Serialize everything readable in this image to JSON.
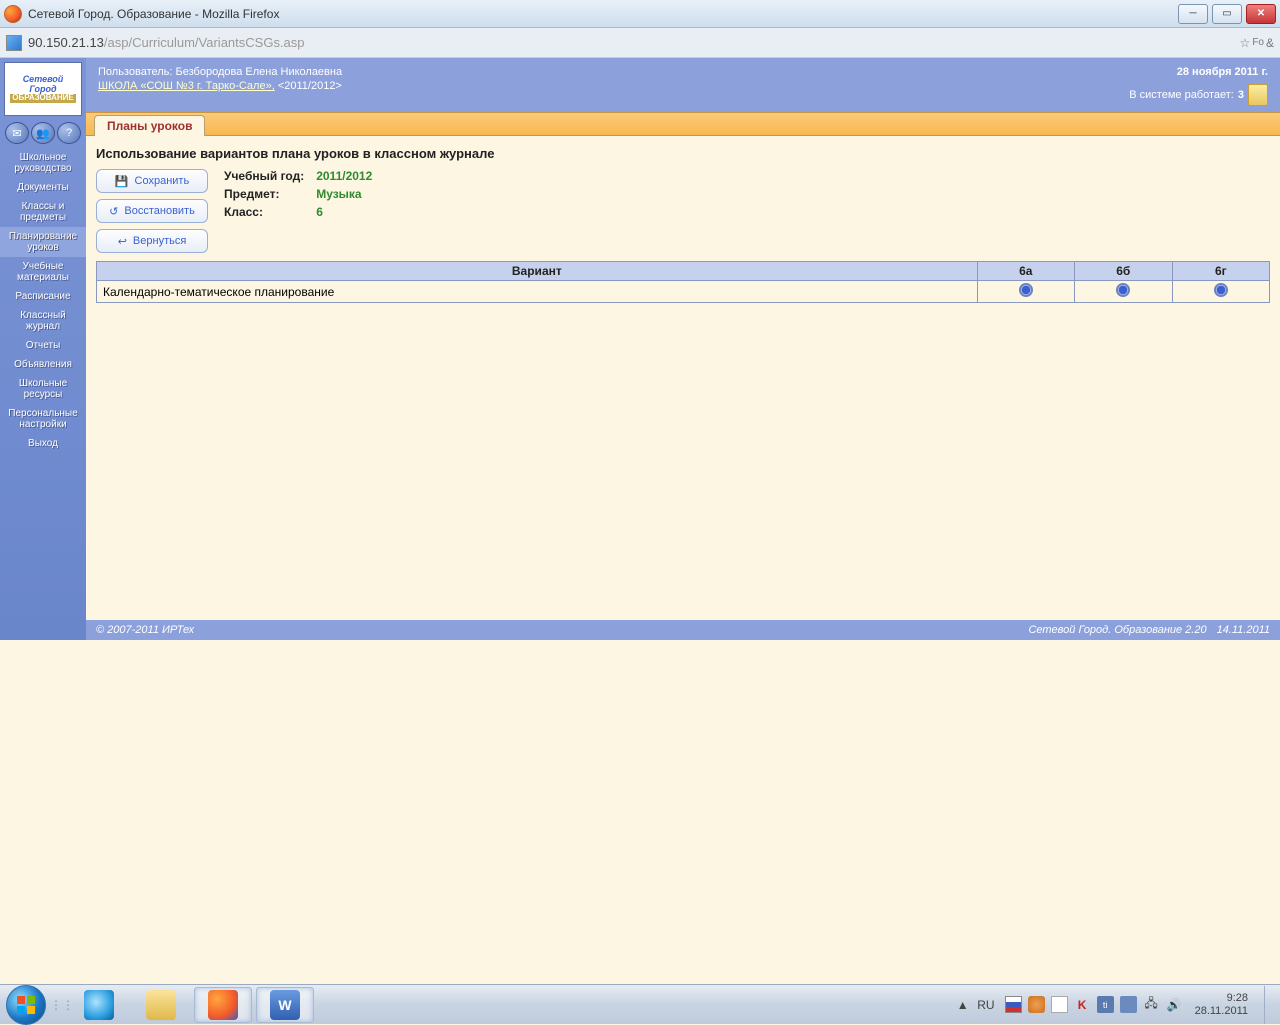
{
  "window": {
    "title": "Сетевой Город. Образование - Mozilla Firefox",
    "url_host": "90.150.21.13",
    "url_path": "/asp/Curriculum/VariantsCSGs.asp"
  },
  "header": {
    "user_label": "Пользователь:",
    "user_name": "Безбородова Елена Николаевна",
    "school_link": "ШКОЛА «СОШ №3 г. Тарко-Сале»,",
    "school_year": "<2011/2012>",
    "date": "28 ноября 2011 г.",
    "online_label": "В системе работает:",
    "online_count": "3"
  },
  "logo": {
    "line1": "Сетевой",
    "line2": "Город",
    "line3": "ОБРАЗОВАНИЕ"
  },
  "sidebar": {
    "items": [
      "Школьное руководство",
      "Документы",
      "Классы и предметы",
      "Планирование уроков",
      "Учебные материалы",
      "Расписание",
      "Классный журнал",
      "Отчеты",
      "Объявления",
      "Школьные ресурсы",
      "Персональные настройки",
      "Выход"
    ],
    "active_index": 3
  },
  "tabs": {
    "active": "Планы уроков"
  },
  "page": {
    "heading": "Использование вариантов плана уроков в классном журнале",
    "buttons": {
      "save": "Сохранить",
      "restore": "Восстановить",
      "back": "Вернуться"
    },
    "info": {
      "year_label": "Учебный год:",
      "year_value": "2011/2012",
      "subject_label": "Предмет:",
      "subject_value": "Музыка",
      "class_label": "Класс:",
      "class_value": "6"
    },
    "table": {
      "col_variant": "Вариант",
      "class_cols": [
        "6а",
        "6б",
        "6г"
      ],
      "row_label": "Календарно-тематическое планирование"
    }
  },
  "footer": {
    "copyright": "© 2007-2011 ИРТех",
    "product": "Сетевой Город. Образование 2.20",
    "build_date": "14.11.2011"
  },
  "taskbar": {
    "lang": "RU",
    "time": "9:28",
    "date": "28.11.2011"
  }
}
